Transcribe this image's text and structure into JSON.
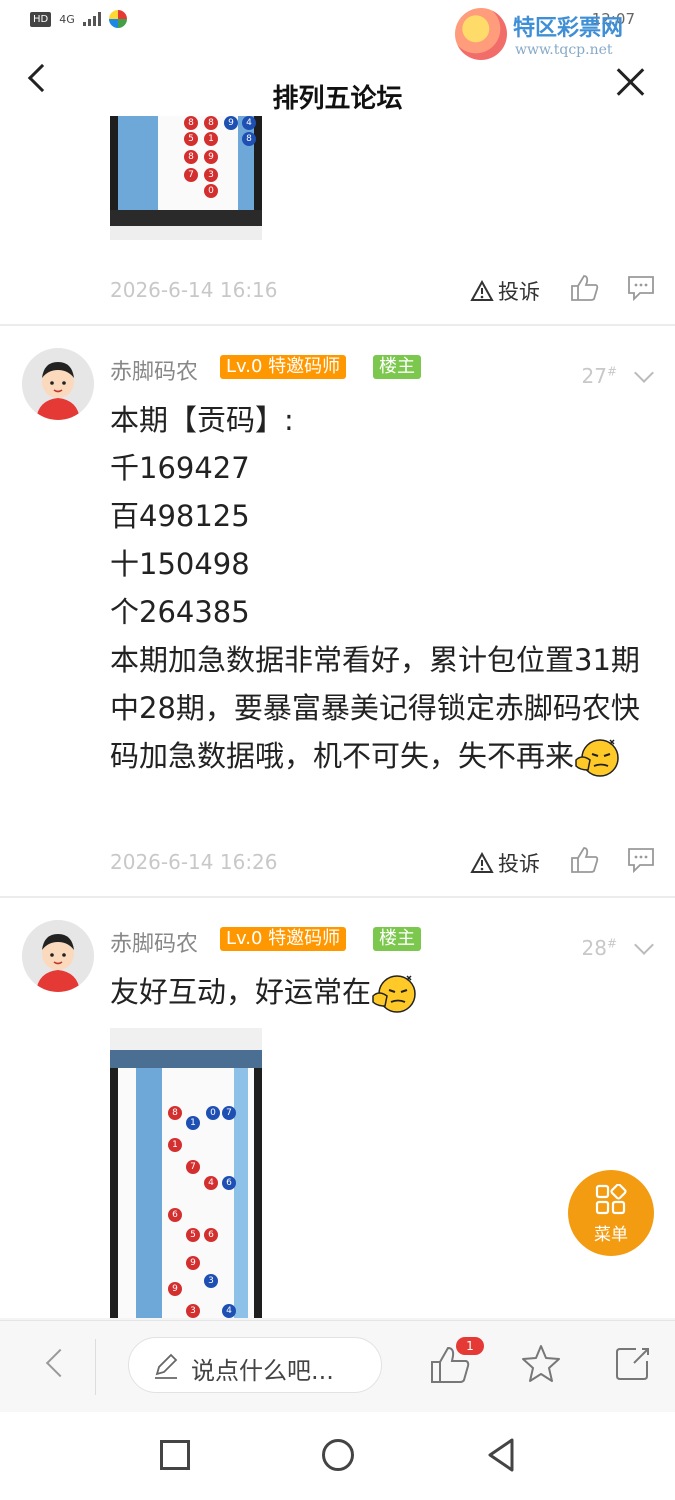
{
  "status_bar": {
    "hd": "HD",
    "network": "4G",
    "time": "12:07"
  },
  "watermark": {
    "name": "特区彩票网",
    "url": "www.tqcp.net"
  },
  "header": {
    "title": "排列五论坛"
  },
  "posts": [
    {
      "timestamp": "2026-6-14 16:16",
      "report_label": "投诉"
    },
    {
      "author": "赤脚码农",
      "level_badge": "Lv.0 特邀码师",
      "host_badge": "楼主",
      "floor": "27",
      "floor_mark": "#",
      "lines": [
        "本期【贡码】:",
        "千169427",
        "百498125",
        "十150498",
        "个264385",
        "本期加急数据非常看好，累计包位置31期中28期，要暴富暴美记得锁定赤脚码农快码加急数据哦，机不可失，失不再来"
      ],
      "timestamp": "2026-6-14 16:26",
      "report_label": "投诉"
    },
    {
      "author": "赤脚码农",
      "level_badge": "Lv.0 特邀码师",
      "host_badge": "楼主",
      "floor": "28",
      "floor_mark": "#",
      "lines": [
        "友好互动，好运常在"
      ]
    }
  ],
  "fab": {
    "label": "菜单",
    "icon": "grid-icon"
  },
  "bottom_bar": {
    "input_placeholder": "说点什么吧...",
    "like_count": "1"
  },
  "colors": {
    "level_badge": "#ff9800",
    "host_badge": "#7cc84e",
    "fab": "#f39c12",
    "like_badge": "#e53935"
  }
}
